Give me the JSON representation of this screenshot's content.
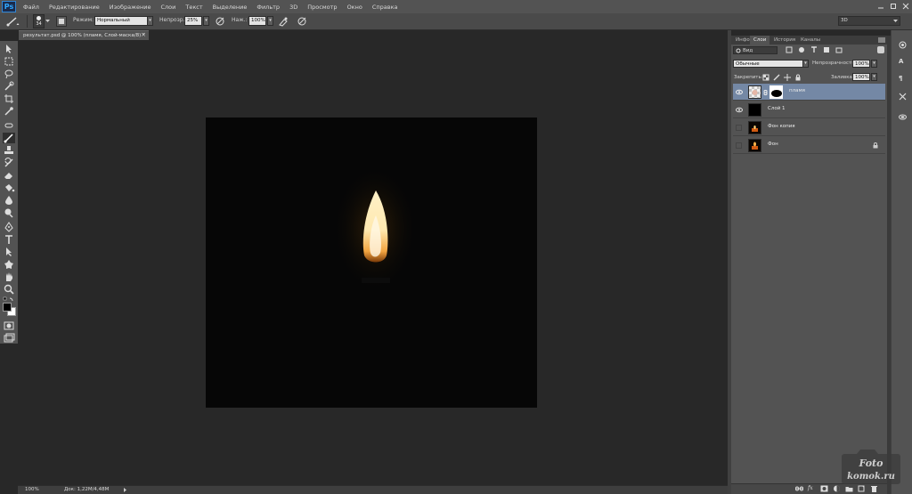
{
  "app": {
    "logo": "Ps"
  },
  "menu": [
    "Файл",
    "Редактирование",
    "Изображение",
    "Слои",
    "Текст",
    "Выделение",
    "Фильтр",
    "3D",
    "Просмотр",
    "Окно",
    "Справка"
  ],
  "options": {
    "brush_size": "34",
    "mode_label": "Режим:",
    "mode_value": "Нормальный",
    "opacity_label": "Непрозр.:",
    "opacity_value": "25%",
    "flow_label": "Наж.:",
    "flow_value": "100%",
    "workspace": "3D"
  },
  "document": {
    "tab_title": "результат.psd @ 100% (пламя, Слой-маска/8) *",
    "close": "×"
  },
  "status": {
    "zoom": "100%",
    "doc_info": "Док: 1,22М/4,48М"
  },
  "panel": {
    "tabs": [
      "Инфо",
      "Слои",
      "История",
      "Каналы"
    ],
    "active_tab": "Слои",
    "kind_label": "Вид",
    "blend_mode": "Обычные",
    "opacity_label": "Непрозрачность:",
    "opacity_value": "100%",
    "lock_label": "Закрепить:",
    "fill_label": "Заливка:",
    "fill_value": "100%",
    "layers": [
      {
        "name": "пламя",
        "visible": true,
        "selected": true
      },
      {
        "name": "Слой 1",
        "visible": true,
        "selected": false
      },
      {
        "name": "Фон копия",
        "visible": false,
        "selected": false
      },
      {
        "name": "Фон",
        "visible": false,
        "selected": false,
        "locked": true
      }
    ]
  },
  "watermark": {
    "line1": "Foto",
    "line2": "komok.ru"
  },
  "colors": {
    "panel_bg": "#535353",
    "canvas_bg": "#282828",
    "selection": "#7488a5",
    "flame": "#ffe9b0"
  }
}
